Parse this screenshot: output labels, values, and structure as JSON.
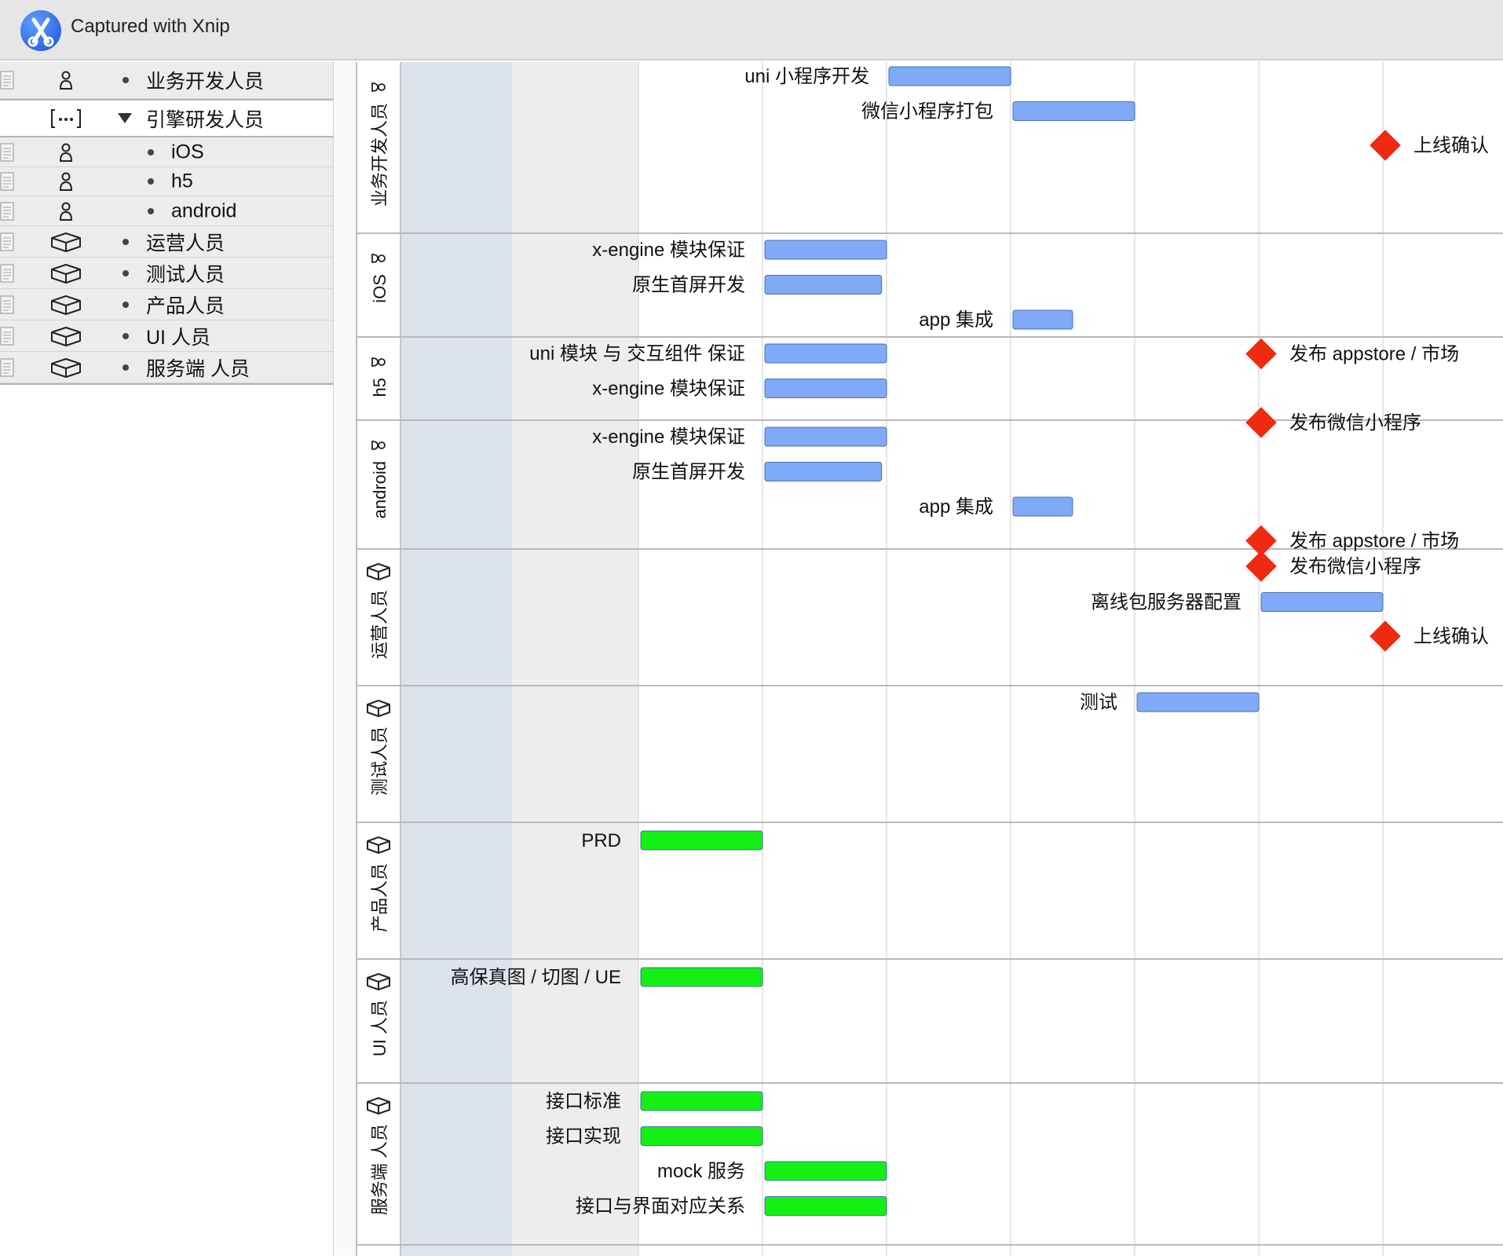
{
  "window": {
    "title": "Captured with Xnip",
    "logo_icon": "xnip-scissors-icon"
  },
  "sidebar": {
    "rows": [
      {
        "label": "业务开发人员",
        "icon": "person-icon",
        "expander": "bullet",
        "indent": 0,
        "selected": false
      },
      {
        "label": "引擎研发人员",
        "icon": "group-bracket-icon",
        "expander": "triangle-down",
        "indent": 0,
        "selected": true
      },
      {
        "label": "iOS",
        "icon": "person-icon",
        "expander": "bullet",
        "indent": 1,
        "selected": false
      },
      {
        "label": "h5",
        "icon": "person-icon",
        "expander": "bullet",
        "indent": 1,
        "selected": false
      },
      {
        "label": "android",
        "icon": "person-icon",
        "expander": "bullet",
        "indent": 1,
        "selected": false
      },
      {
        "label": "运营人员",
        "icon": "cube-icon",
        "expander": "bullet",
        "indent": 0,
        "selected": false
      },
      {
        "label": "测试人员",
        "icon": "cube-icon",
        "expander": "bullet",
        "indent": 0,
        "selected": false
      },
      {
        "label": "产品人员",
        "icon": "cube-icon",
        "expander": "bullet",
        "indent": 0,
        "selected": false
      },
      {
        "label": "UI 人员",
        "icon": "cube-icon",
        "expander": "bullet",
        "indent": 0,
        "selected": false
      },
      {
        "label": "服务端 人员",
        "icon": "cube-icon",
        "expander": "bullet",
        "indent": 0,
        "selected": false
      }
    ]
  },
  "gantt": {
    "colors": {
      "task_blue": "#7eaaf7",
      "task_green": "#14f014",
      "milestone_red": "#f02a10",
      "grid": "#dedede",
      "lane_border": "#b9b9b9"
    },
    "lanes": [
      {
        "label": "业务开发人员",
        "icon": "person-icon",
        "items": [
          {
            "label": "uni 小程序开发",
            "kind": "task",
            "color": "blue",
            "start": 2,
            "end": 3
          },
          {
            "label": "微信小程序打包",
            "kind": "task",
            "color": "blue",
            "start": 3,
            "end": 4
          },
          {
            "label": "上线确认",
            "kind": "milestone",
            "at": 6
          }
        ]
      },
      {
        "label": "iOS",
        "icon": "person-icon",
        "items": [
          {
            "label": "x-engine 模块保证",
            "kind": "task",
            "color": "blue",
            "start": 1,
            "end": 2
          },
          {
            "label": "原生首屏开发",
            "kind": "task",
            "color": "blue",
            "start": 1,
            "end": 1.96
          },
          {
            "label": "app 集成",
            "kind": "task",
            "color": "blue",
            "start": 3,
            "end": 3.5
          },
          {
            "label": "发布 appstore / 市场",
            "kind": "milestone",
            "at": 5
          }
        ]
      },
      {
        "label": "h5",
        "icon": "person-icon",
        "items": [
          {
            "label": "uni 模块 与 交互组件 保证",
            "kind": "task",
            "color": "blue",
            "start": 1,
            "end": 2
          },
          {
            "label": "x-engine 模块保证",
            "kind": "task",
            "color": "blue",
            "start": 1,
            "end": 2
          },
          {
            "label": "发布微信小程序",
            "kind": "milestone",
            "at": 5
          }
        ]
      },
      {
        "label": "android",
        "icon": "person-icon",
        "items": [
          {
            "label": "x-engine 模块保证",
            "kind": "task",
            "color": "blue",
            "start": 1,
            "end": 2
          },
          {
            "label": "原生首屏开发",
            "kind": "task",
            "color": "blue",
            "start": 1,
            "end": 1.96
          },
          {
            "label": "app 集成",
            "kind": "task",
            "color": "blue",
            "start": 3,
            "end": 3.5
          },
          {
            "label": "发布 appstore / 市场",
            "kind": "milestone",
            "at": 5
          }
        ]
      },
      {
        "label": "运营人员",
        "icon": "cube-icon",
        "items": [
          {
            "label": "发布微信小程序",
            "kind": "milestone",
            "at": 5
          },
          {
            "label": "离线包服务器配置",
            "kind": "task",
            "color": "blue",
            "start": 5,
            "end": 6
          },
          {
            "label": "上线确认",
            "kind": "milestone",
            "at": 6
          }
        ]
      },
      {
        "label": "测试人员",
        "icon": "cube-icon",
        "items": [
          {
            "label": "测试",
            "kind": "task",
            "color": "blue",
            "start": 4,
            "end": 5
          }
        ]
      },
      {
        "label": "产品人员",
        "icon": "cube-icon",
        "items": [
          {
            "label": "PRD",
            "kind": "task",
            "color": "green",
            "start": 0,
            "end": 1
          }
        ]
      },
      {
        "label": "UI 人员",
        "icon": "cube-icon",
        "items": [
          {
            "label": "高保真图 / 切图 / UE",
            "kind": "task",
            "color": "green",
            "start": 0,
            "end": 1
          }
        ]
      },
      {
        "label": "服务端 人员",
        "icon": "cube-icon",
        "items": [
          {
            "label": "接口标准",
            "kind": "task",
            "color": "green",
            "start": 0,
            "end": 1
          },
          {
            "label": "接口实现",
            "kind": "task",
            "color": "green",
            "start": 0,
            "end": 1
          },
          {
            "label": "mock 服务",
            "kind": "task",
            "color": "green",
            "start": 1,
            "end": 2
          },
          {
            "label": "接口与界面对应关系",
            "kind": "task",
            "color": "green",
            "start": 1,
            "end": 2
          }
        ]
      }
    ]
  }
}
